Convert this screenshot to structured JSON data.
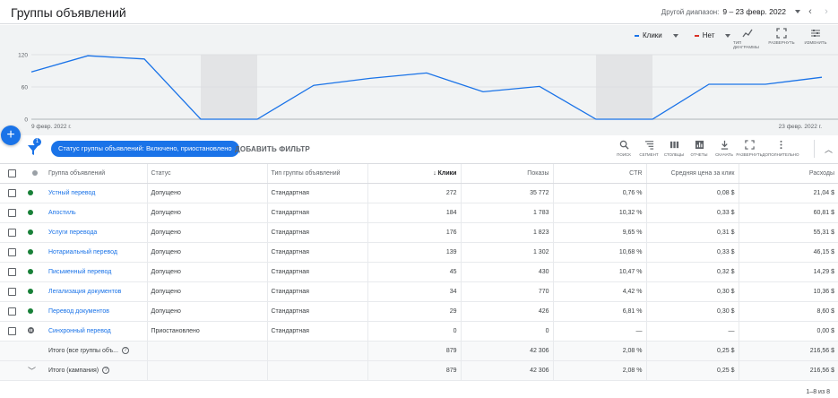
{
  "header": {
    "title": "Группы объявлений",
    "date_range_label": "Другой диапазон:",
    "date_range_value": "9 – 23 февр. 2022"
  },
  "chart": {
    "metric1_label": "Клики",
    "metric1_color": "#1a73e8",
    "metric2_label": "Нет",
    "metric2_color": "#d93025",
    "tools": [
      "ТИП ДИАГРАММЫ",
      "РАЗВЕРНУТЬ",
      "ИЗМЕНИТЬ"
    ]
  },
  "chart_data": {
    "type": "line",
    "x_start_label": "9 февр. 2022 г.",
    "x_end_label": "23 февр. 2022 г.",
    "yticks": [
      "120",
      "60",
      "0"
    ],
    "ylim": [
      0,
      120
    ],
    "series": [
      {
        "name": "Клики",
        "color": "#1a73e8",
        "values": [
          88,
          118,
          112,
          0,
          0,
          63,
          76,
          86,
          51,
          61,
          0,
          0,
          65,
          65,
          78
        ]
      }
    ],
    "shaded_ranges": [
      [
        3,
        4
      ],
      [
        10,
        11
      ]
    ]
  },
  "toolbar": {
    "fab_label": "+",
    "filter_count": "1",
    "chip_label": "Статус группы объявлений: Включено, приостановлено",
    "add_filter_label": "ДОБАВИТЬ ФИЛЬТР",
    "tools": [
      "ПОИСК",
      "СЕГМЕНТ",
      "СТОЛБЦЫ",
      "ОТЧЕТЫ",
      "СКАЧАТЬ",
      "РАЗВЕРНУТЬ",
      "ДОПОЛНИТЕЛЬНО"
    ]
  },
  "table": {
    "headers": {
      "name": "Группа объявлений",
      "status": "Статус",
      "type": "Тип группы объявлений",
      "clicks": "Клики",
      "impressions": "Показы",
      "ctr": "CTR",
      "avg_cpc": "Средняя цена за клик",
      "cost": "Расходы"
    },
    "rows": [
      {
        "name": "Устный перевод",
        "status": "Допущено",
        "type": "Стандартная",
        "clicks": "272",
        "impressions": "35 772",
        "ctr": "0,76 %",
        "avg_cpc": "0,08 $",
        "cost": "21,04 $",
        "state": "enabled"
      },
      {
        "name": "Апостиль",
        "status": "Допущено",
        "type": "Стандартная",
        "clicks": "184",
        "impressions": "1 783",
        "ctr": "10,32 %",
        "avg_cpc": "0,33 $",
        "cost": "60,81 $",
        "state": "enabled"
      },
      {
        "name": "Услуги перевода",
        "status": "Допущено",
        "type": "Стандартная",
        "clicks": "176",
        "impressions": "1 823",
        "ctr": "9,65 %",
        "avg_cpc": "0,31 $",
        "cost": "55,31 $",
        "state": "enabled"
      },
      {
        "name": "Нотариальный перевод",
        "status": "Допущено",
        "type": "Стандартная",
        "clicks": "139",
        "impressions": "1 302",
        "ctr": "10,68 %",
        "avg_cpc": "0,33 $",
        "cost": "46,15 $",
        "state": "enabled"
      },
      {
        "name": "Письменный перевод",
        "status": "Допущено",
        "type": "Стандартная",
        "clicks": "45",
        "impressions": "430",
        "ctr": "10,47 %",
        "avg_cpc": "0,32 $",
        "cost": "14,29 $",
        "state": "enabled"
      },
      {
        "name": "Легализация документов",
        "status": "Допущено",
        "type": "Стандартная",
        "clicks": "34",
        "impressions": "770",
        "ctr": "4,42 %",
        "avg_cpc": "0,30 $",
        "cost": "10,36 $",
        "state": "enabled"
      },
      {
        "name": "Перевод документов",
        "status": "Допущено",
        "type": "Стандартная",
        "clicks": "29",
        "impressions": "426",
        "ctr": "6,81 %",
        "avg_cpc": "0,30 $",
        "cost": "8,60 $",
        "state": "enabled"
      },
      {
        "name": "Синхронный перевод",
        "status": "Приостановлено",
        "type": "Стандартная",
        "clicks": "0",
        "impressions": "0",
        "ctr": "—",
        "avg_cpc": "—",
        "cost": "0,00 $",
        "state": "paused"
      }
    ],
    "total_all": {
      "label": "Итого (все группы объ...",
      "clicks": "879",
      "impressions": "42 306",
      "ctr": "2,08 %",
      "avg_cpc": "0,25 $",
      "cost": "216,56 $"
    },
    "total_campaign": {
      "label": "Итого (кампания)",
      "clicks": "879",
      "impressions": "42 306",
      "ctr": "2,08 %",
      "avg_cpc": "0,25 $",
      "cost": "216,56 $"
    }
  },
  "footer": {
    "pagination": "1–8 из 8"
  }
}
